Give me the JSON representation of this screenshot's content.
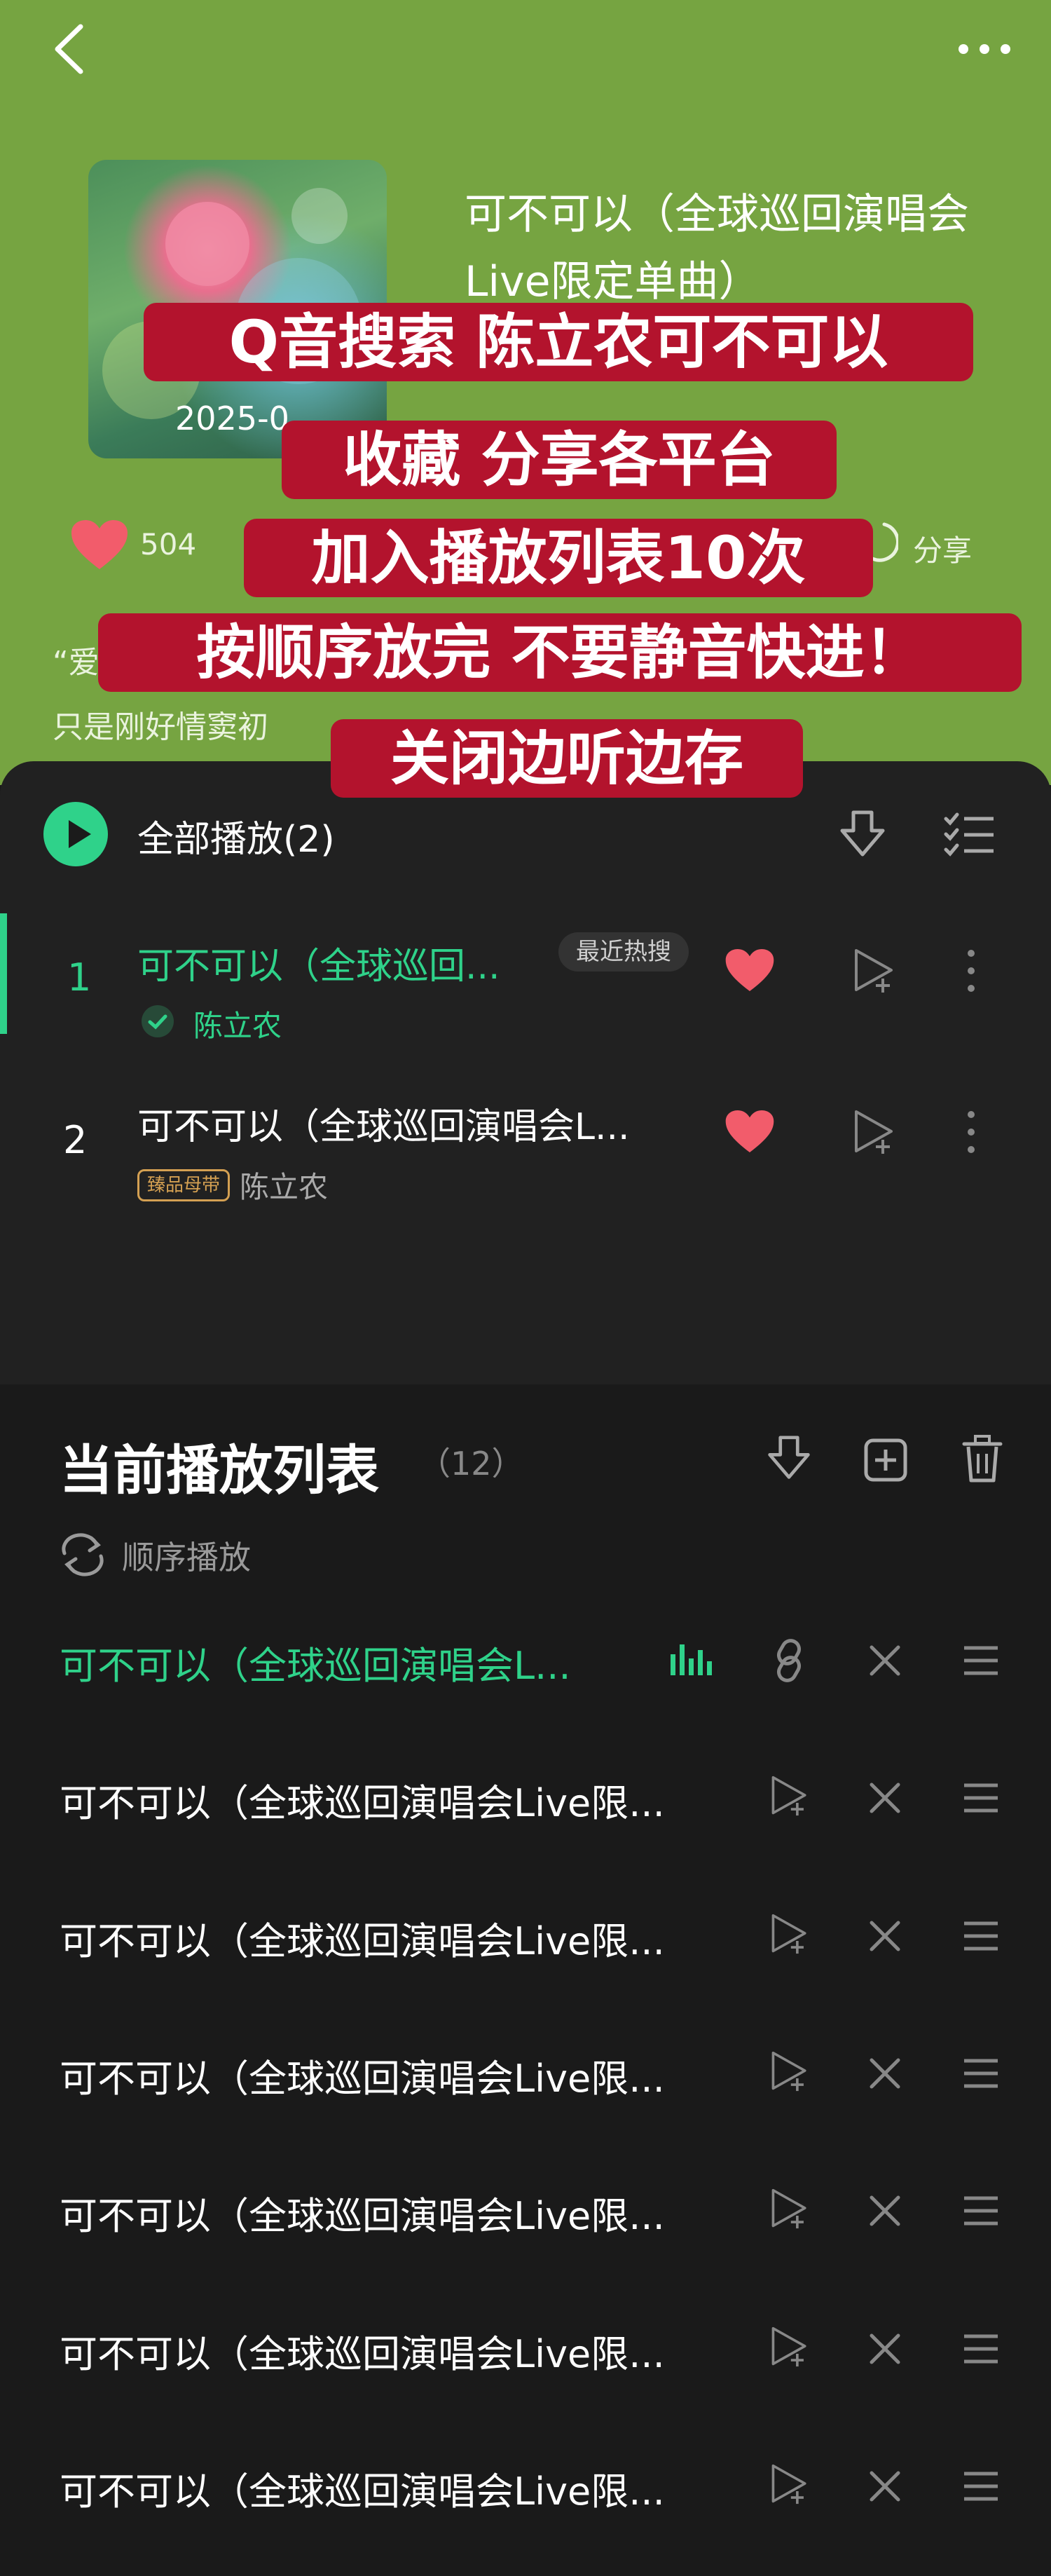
{
  "header": {
    "back_icon": "back-chevron-icon",
    "more_icon": "more-dots-icon"
  },
  "album": {
    "date": "2025-0"
  },
  "song": {
    "title": "可不可以（全球巡回演唱会Live限定单曲）"
  },
  "actions": {
    "likes": "504",
    "share_label": "分享"
  },
  "description": {
    "line1": "“爱",
    "line2": "只是刚好情窦初"
  },
  "overlay": {
    "lines": [
      "Q音搜索 陈立农可不可以",
      "收藏 分享各平台",
      "加入播放列表10次",
      "按顺序放完 不要静音快进！",
      "关闭边听边存"
    ],
    "color": "#b3132d"
  },
  "playlist": {
    "play_all_label": "全部播放(2)",
    "songs": [
      {
        "num": "1",
        "title": "可不可以（全球巡回...",
        "badge": "最近热搜",
        "artist": "陈立农"
      },
      {
        "num": "2",
        "title": "可不可以（全球巡回演唱会L...",
        "quality": "臻品母带",
        "artist": "陈立农"
      }
    ]
  },
  "queue": {
    "title": "当前播放列表",
    "count": "（12）",
    "mode_label": "顺序播放",
    "items": [
      "可不可以（全球巡回演唱会L...",
      "可不可以（全球巡回演唱会Live限...",
      "可不可以（全球巡回演唱会Live限...",
      "可不可以（全球巡回演唱会Live限...",
      "可不可以（全球巡回演唱会Live限...",
      "可不可以（全球巡回演唱会Live限...",
      "可不可以（全球巡回演唱会Live限..."
    ]
  },
  "colors": {
    "accent": "#2fd28a",
    "heart": "#f25c6b",
    "header_bg": "#76a441",
    "panel_bg": "#212121",
    "queue_bg": "#1a1a1a"
  }
}
